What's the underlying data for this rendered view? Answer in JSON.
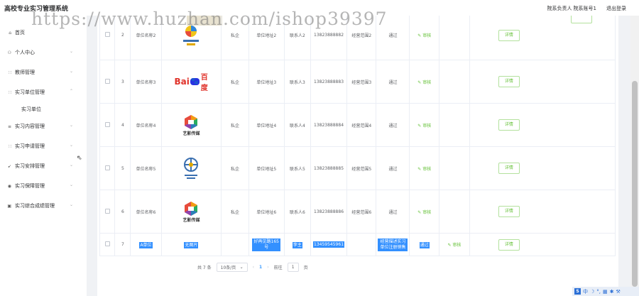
{
  "header": {
    "title": "高校专业实习管理系统",
    "role": "院系负责人",
    "account": "院系账号1",
    "logout": "退出登录"
  },
  "watermark": "https://www.huzhan.com/ishop39397",
  "sidebar": {
    "items": [
      {
        "label": "首页",
        "icon": "home-icon",
        "glyph": "⌂"
      },
      {
        "label": "个人中心",
        "icon": "user-icon",
        "glyph": "⚇"
      },
      {
        "label": "教师管理",
        "icon": "grid-icon",
        "glyph": "∷"
      },
      {
        "label": "实习单位管理",
        "icon": "grid-icon",
        "glyph": "∷"
      },
      {
        "label": "实习内容管理",
        "icon": "list-icon",
        "glyph": "≡"
      },
      {
        "label": "实习申请管理",
        "icon": "grid-icon",
        "glyph": "∷"
      },
      {
        "label": "实习安排管理",
        "icon": "send-icon",
        "glyph": "➹"
      },
      {
        "label": "实习保障管理",
        "icon": "shield-icon",
        "glyph": "◉"
      },
      {
        "label": "实习综合成绩管理",
        "icon": "folder-icon",
        "glyph": "▣"
      }
    ],
    "sub_item": "实习单位"
  },
  "table": {
    "rows": [
      {
        "idx": "2",
        "name": "单位名称2",
        "logo": "logo-2",
        "nature": "私企",
        "address": "单位地址2",
        "contact": "联系人2",
        "phone": "13823888882",
        "scope": "经营范围2",
        "status": "通过",
        "audit": "审核",
        "detail": "详情"
      },
      {
        "idx": "3",
        "name": "单位名称3",
        "logo": "baidu",
        "nature": "私企",
        "address": "单位地址3",
        "contact": "联系人3",
        "phone": "13823888883",
        "scope": "经营范围3",
        "status": "通过",
        "audit": "审核",
        "detail": "详情"
      },
      {
        "idx": "4",
        "name": "单位名称4",
        "logo": "yiying",
        "nature": "私企",
        "address": "单位地址4",
        "contact": "联系人4",
        "phone": "13823888884",
        "scope": "经营范围4",
        "status": "通过",
        "audit": "审核",
        "detail": "详情"
      },
      {
        "idx": "5",
        "name": "单位名称5",
        "logo": "logo-5",
        "nature": "私企",
        "address": "单位地址5",
        "contact": "联系人5",
        "phone": "13823888885",
        "scope": "经营范围5",
        "status": "通过",
        "audit": "审核",
        "detail": "详情"
      },
      {
        "idx": "6",
        "name": "单位名称6",
        "logo": "yiying",
        "nature": "私企",
        "address": "单位地址6",
        "contact": "联系人6",
        "phone": "13823888886",
        "scope": "经营范围6",
        "status": "通过",
        "audit": "审核",
        "detail": "详情"
      },
      {
        "idx": "7",
        "name": "A单位",
        "logo": "无图片",
        "nature": "",
        "address": "好再见路165号",
        "contact": "李主",
        "phone": "13459545961",
        "scope": "经营描述实习单位注册销售",
        "status": "通过",
        "audit": "审核",
        "detail": "详情"
      }
    ],
    "logo_text_yiying": "艺影传媒",
    "logo_text_baidu_a": "Bai",
    "logo_text_baidu_b": "百度"
  },
  "pagination": {
    "total": "共 7 条",
    "page_size": "10条/页",
    "current": "1",
    "goto_label": "前往",
    "goto_value": "1",
    "page_unit": "页"
  },
  "colors": {
    "accent": "#409eff",
    "success": "#67c23a",
    "selection": "#3390ff"
  }
}
